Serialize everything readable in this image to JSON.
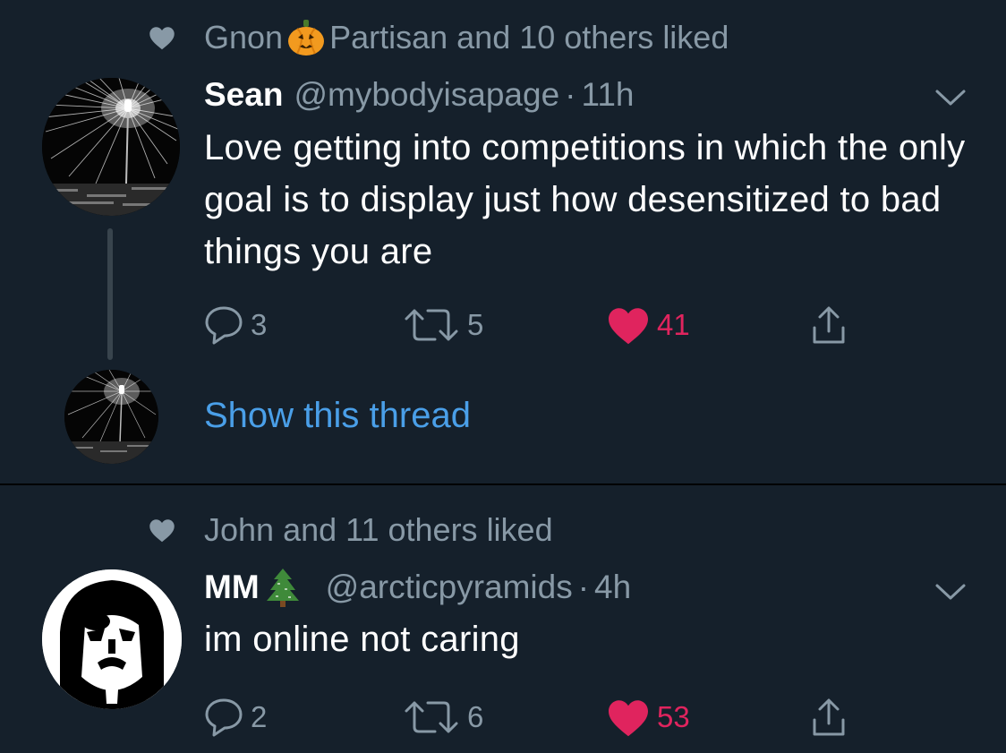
{
  "colors": {
    "background": "#15202b",
    "secondary_text": "#8899a6",
    "link": "#4a9fe8",
    "like": "#e0245e",
    "divider": "#000000"
  },
  "tweets": [
    {
      "social_context": {
        "icon": "heart-icon",
        "name_before": "Gnon",
        "emoji": "pumpkin-icon",
        "name_after": "Partisan and 10 others liked"
      },
      "display_name": "Sean",
      "handle": "@mybodyisapage",
      "separator": "·",
      "time": "11h",
      "text": "Love getting into competitions in which the only goal is to display just how desensitized to bad things you are",
      "actions": {
        "replies": "3",
        "retweets": "5",
        "likes": "41",
        "liked": true
      },
      "show_thread": "Show this thread"
    },
    {
      "social_context": {
        "icon": "heart-icon",
        "text": "John and 11 others liked"
      },
      "display_name": "MM",
      "name_emoji": "evergreen-tree-icon",
      "handle": "@arcticpyramids",
      "separator": "·",
      "time": "4h",
      "text": "im online not caring",
      "actions": {
        "replies": "2",
        "retweets": "6",
        "likes": "53",
        "liked": true
      }
    }
  ]
}
